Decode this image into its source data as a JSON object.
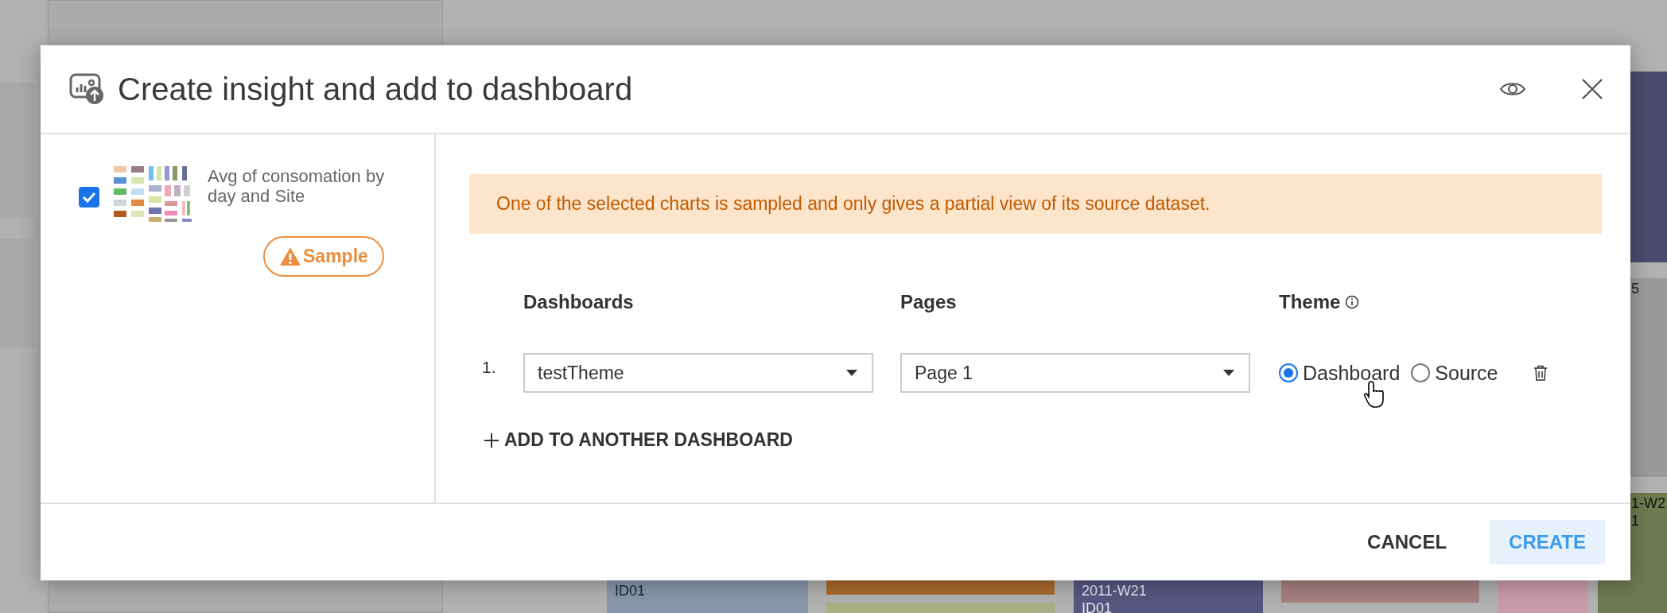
{
  "background_tiles": [
    {
      "lines": [
        "ID01"
      ]
    },
    {
      "lines": [
        "2011-W21",
        "ID01"
      ]
    },
    {
      "lines": [
        "5"
      ]
    },
    {
      "lines": [
        "1-W2",
        "1"
      ]
    }
  ],
  "dialog": {
    "title": "Create insight and add to dashboard",
    "item": {
      "label": "Avg of consomation by day and Site",
      "checked": true,
      "badge": "Sample"
    },
    "warning": "One of the selected charts is sampled and only gives a partial view of its source dataset.",
    "columns": [
      "Dashboards",
      "Pages",
      "Theme"
    ],
    "rows": [
      {
        "index": "1.",
        "dashboard": "testTheme",
        "page": "Page 1",
        "theme_options": [
          {
            "label": "Dashboard",
            "selected": true
          },
          {
            "label": "Source",
            "selected": false
          }
        ]
      }
    ],
    "add_link": "ADD TO ANOTHER DASHBOARD",
    "buttons": [
      {
        "label": "CANCEL",
        "kind": "text"
      },
      {
        "label": "CREATE",
        "kind": "primary"
      }
    ]
  }
}
